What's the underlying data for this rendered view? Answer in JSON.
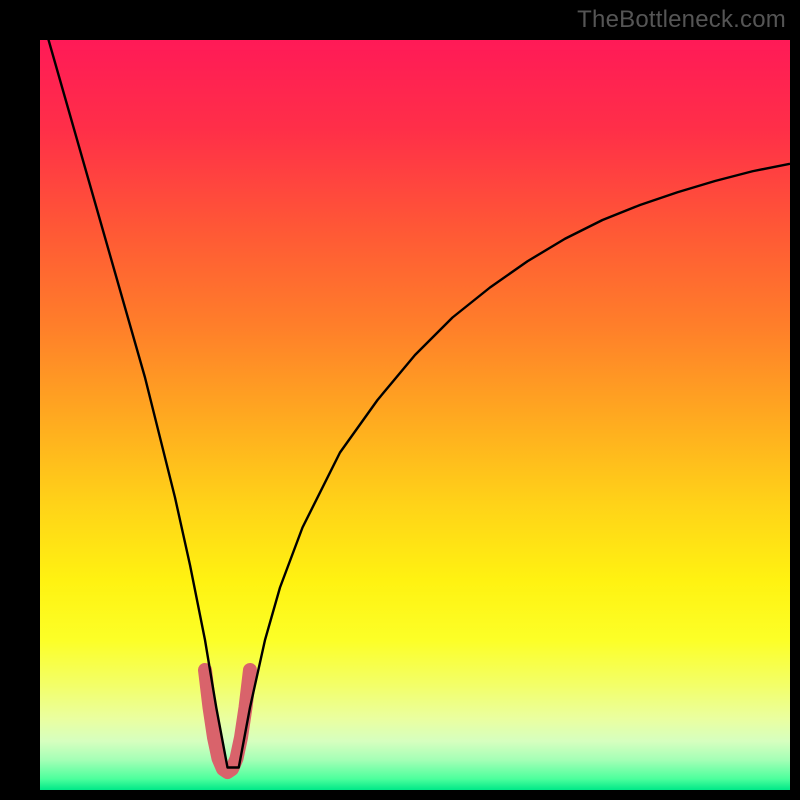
{
  "watermark": "TheBottleneck.com",
  "chart_data": {
    "type": "line",
    "title": "",
    "xlabel": "",
    "ylabel": "",
    "xlim": [
      0,
      100
    ],
    "ylim": [
      0,
      100
    ],
    "grid": false,
    "legend": false,
    "background_gradient": {
      "stops": [
        {
          "offset": 0.0,
          "color": "#ff1a57"
        },
        {
          "offset": 0.12,
          "color": "#ff2f48"
        },
        {
          "offset": 0.25,
          "color": "#ff5736"
        },
        {
          "offset": 0.38,
          "color": "#ff7e2a"
        },
        {
          "offset": 0.5,
          "color": "#ffa820"
        },
        {
          "offset": 0.62,
          "color": "#ffd318"
        },
        {
          "offset": 0.72,
          "color": "#fff211"
        },
        {
          "offset": 0.8,
          "color": "#fcff27"
        },
        {
          "offset": 0.86,
          "color": "#f3ff68"
        },
        {
          "offset": 0.905,
          "color": "#eaffa0"
        },
        {
          "offset": 0.935,
          "color": "#d6ffbf"
        },
        {
          "offset": 0.96,
          "color": "#a4ffb6"
        },
        {
          "offset": 0.985,
          "color": "#4dff9d"
        },
        {
          "offset": 1.0,
          "color": "#00e888"
        }
      ]
    },
    "series": [
      {
        "name": "v-curve",
        "color": "#000000",
        "stroke_width": 2.4,
        "x": [
          0,
          2,
          4,
          6,
          8,
          10,
          12,
          14,
          16,
          18,
          20,
          22,
          23.5,
          25,
          26.5,
          28,
          30,
          32,
          35,
          40,
          45,
          50,
          55,
          60,
          65,
          70,
          75,
          80,
          85,
          90,
          95,
          100
        ],
        "y": [
          104,
          97,
          90,
          83,
          76,
          69,
          62,
          55,
          47,
          39,
          30,
          20,
          11,
          3,
          3,
          11,
          20,
          27,
          35,
          45,
          52,
          58,
          63,
          67,
          70.5,
          73.5,
          76,
          78,
          79.7,
          81.2,
          82.5,
          83.5
        ]
      },
      {
        "name": "u-marker",
        "color": "#d9636b",
        "stroke_width": 14,
        "linecap": "round",
        "x": [
          22.0,
          22.6,
          23.2,
          23.8,
          24.4,
          25.0,
          25.6,
          26.2,
          26.8,
          27.4,
          28.0
        ],
        "y": [
          16.0,
          11.0,
          7.0,
          4.2,
          2.8,
          2.4,
          2.8,
          4.2,
          7.0,
          11.0,
          16.0
        ]
      }
    ]
  }
}
